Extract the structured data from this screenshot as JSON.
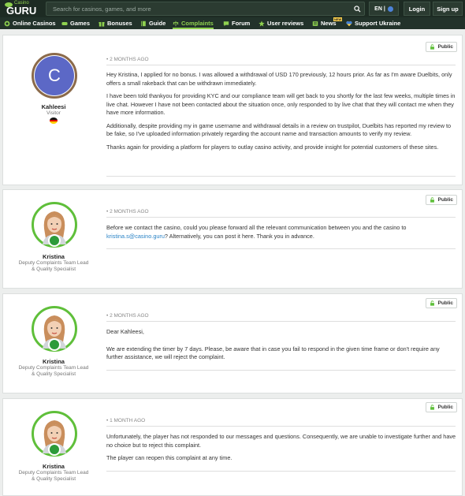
{
  "header": {
    "logo_small": "Casino",
    "logo_big": "GURU",
    "search_placeholder": "Search for casinos, games, and more",
    "lang": "EN |",
    "login": "Login",
    "signup": "Sign up"
  },
  "nav": {
    "items": [
      {
        "label": "Online Casinos",
        "icon": "casino-chip-icon"
      },
      {
        "label": "Games",
        "icon": "gamepad-icon"
      },
      {
        "label": "Bonuses",
        "icon": "gift-icon"
      },
      {
        "label": "Guide",
        "icon": "book-icon"
      },
      {
        "label": "Complaints",
        "icon": "scale-icon"
      },
      {
        "label": "Forum",
        "icon": "chat-icon"
      },
      {
        "label": "User reviews",
        "icon": "star-icon"
      },
      {
        "label": "News",
        "icon": "newspaper-icon"
      },
      {
        "label": "Support Ukraine",
        "icon": "ukraine-heart-icon"
      }
    ],
    "news_badge": "NEW"
  },
  "public_label": "Public",
  "posts": [
    {
      "author": "Kahleesi",
      "role": "Visitor",
      "avatar_letter": "C",
      "date": "2 MONTHS AGO",
      "paragraphs": [
        "Hey Kristina, I applied for no bonus. I was allowed a withdrawal of USD 170 previously, 12 hours prior. As far as I'm aware Duelbits, only offers a small rakeback that can be withdrawn immediately.",
        "I have been told thankyou for providing KYC and our compliance team will get back to you shortly for the last few weeks, multiple times in live chat. However I have not been contacted about the situation once, only responded to by live chat that they will contact me when they have more information.",
        "Additionally, despite providing my in game username and withdrawal details in a review on trustpilot, Duelbits has reported my review to be fake, so I've uploaded information privately regarding the account name and transaction amounts to verify my review.",
        "Thanks again for providing a platform for players to outlay casino activity, and provide insight for potential customers of these sites."
      ]
    },
    {
      "author": "Kristina",
      "role": "Deputy Complaints Team Lead & Quality Specialist",
      "date": "2 MONTHS AGO",
      "text_before_link": "Before we contact the casino, could you please forward all the relevant communication between you and the casino to ",
      "link": "kristina.s@casino.guru",
      "text_after_link": "? Alternatively, you can post it here. Thank you in advance."
    },
    {
      "author": "Kristina",
      "role": "Deputy Complaints Team Lead & Quality Specialist",
      "date": "2 MONTHS AGO",
      "paragraphs": [
        "Dear Kahleesi,",
        "We are extending the timer by 7 days. Please, be aware that in case you fail to respond in the given time frame or don't require any further assistance, we will reject the complaint."
      ]
    },
    {
      "author": "Kristina",
      "role": "Deputy Complaints Team Lead & Quality Specialist",
      "date": "1 MONTH AGO",
      "paragraphs": [
        "Unfortunately, the player has not responded to our messages and questions. Consequently, we are unable to investigate further and have no choice but to reject this complaint.",
        "The player can reopen this complaint at any time."
      ]
    }
  ]
}
